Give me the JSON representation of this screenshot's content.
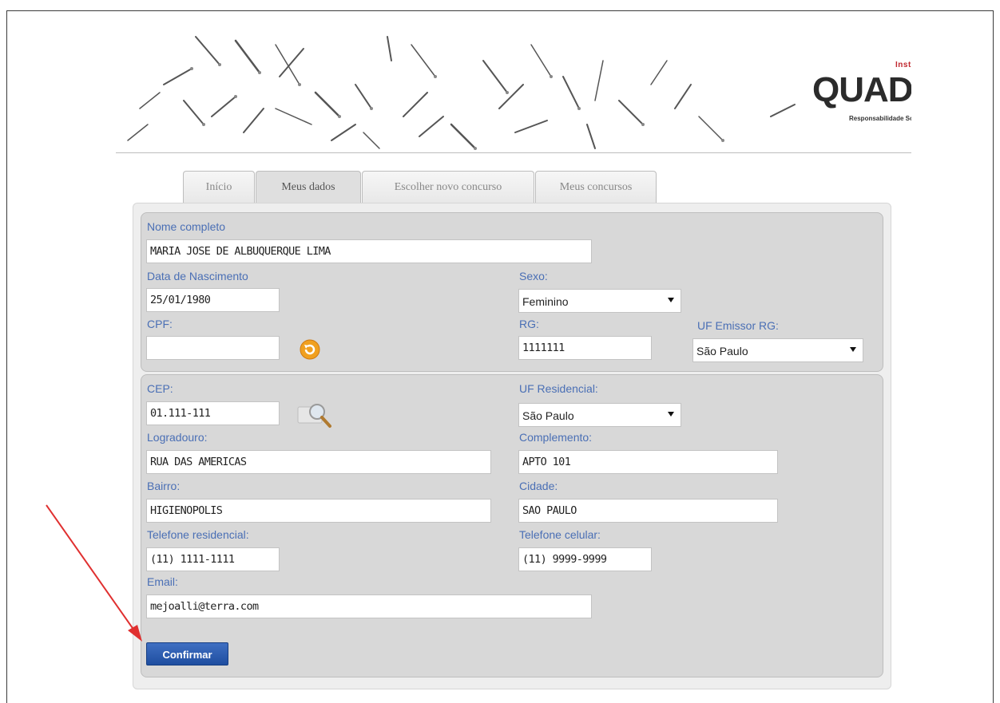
{
  "header": {
    "logo_instituto": "Instituto",
    "logo_word": "QUADRIX",
    "logo_subtitle": "Responsabilidade Social"
  },
  "tabs": [
    {
      "label": "Início"
    },
    {
      "label": "Meus dados"
    },
    {
      "label": "Escolher novo concurso"
    },
    {
      "label": "Meus concursos"
    }
  ],
  "personal": {
    "nome_label": "Nome completo",
    "nome_value": "MARIA JOSE DE ALBUQUERQUE LIMA",
    "nascimento_label": "Data de Nascimento",
    "nascimento_value": "25/01/1980",
    "sexo_label": "Sexo:",
    "sexo_value": "Feminino",
    "cpf_label": "CPF:",
    "cpf_value": "",
    "rg_label": "RG:",
    "rg_value": "1111111",
    "uf_rg_label": "UF Emissor RG:",
    "uf_rg_value": "São Paulo"
  },
  "address": {
    "cep_label": "CEP:",
    "cep_value": "01.111-111",
    "uf_res_label": "UF Residencial:",
    "uf_res_value": "São Paulo",
    "logradouro_label": "Logradouro:",
    "logradouro_value": "RUA DAS AMERICAS",
    "complemento_label": "Complemento:",
    "complemento_value": "APTO 101",
    "bairro_label": "Bairro:",
    "bairro_value": "HIGIENOPOLIS",
    "cidade_label": "Cidade:",
    "cidade_value": "SAO PAULO",
    "tel_res_label": "Telefone residencial:",
    "tel_res_value": "(11) 1111-1111",
    "tel_cel_label": "Telefone celular:",
    "tel_cel_value": "(11) 9999-9999",
    "email_label": "Email:",
    "email_value": "mejoalli@terra.com"
  },
  "actions": {
    "confirm_label": "Confirmar"
  },
  "colors": {
    "label_blue": "#4a6fb5",
    "button_blue": "#2556a8",
    "brand_red": "#c0282f",
    "annotation_arrow": "#e03030"
  },
  "icons": [
    "refresh-icon",
    "search-magnifier-icon",
    "chevron-down-icon",
    "annotation-arrow"
  ]
}
